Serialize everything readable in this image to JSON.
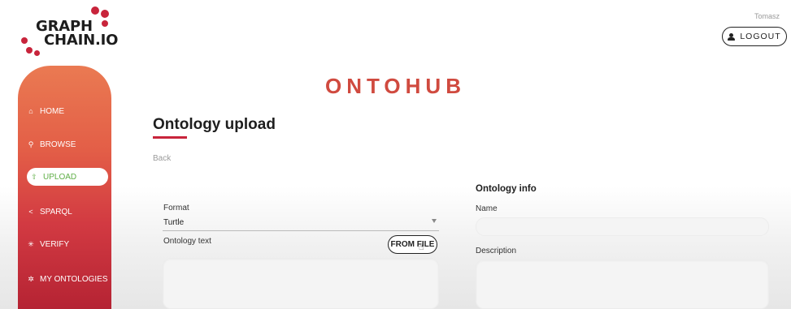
{
  "logo": {
    "line1": "GRAPH",
    "line2": "CHAIN.IO"
  },
  "header": {
    "username": "Tomasz",
    "logout_label": "LOGOUT",
    "logout_icon": "user-icon"
  },
  "sidebar": {
    "items": [
      {
        "label": "HOME",
        "icon": "home-icon",
        "glyph": "⌂"
      },
      {
        "label": "BROWSE",
        "icon": "search-icon",
        "glyph": "⚲"
      },
      {
        "label": "UPLOAD",
        "icon": "upload-icon",
        "glyph": "⇧"
      },
      {
        "label": "SPARQL",
        "icon": "share-icon",
        "glyph": "<"
      },
      {
        "label": "VERIFY",
        "icon": "verify-icon",
        "glyph": "✳"
      },
      {
        "label": "MY ONTOLOGIES",
        "icon": "gear-icon",
        "glyph": "✲"
      }
    ],
    "active": "UPLOAD",
    "colors": {
      "top": "#ea7a52",
      "bottom": "#b52333",
      "active_text": "#5fae46"
    }
  },
  "main": {
    "app_title": "ONTOHUB",
    "page_title": "Ontology upload",
    "back_label": "Back",
    "format": {
      "label": "Format",
      "selected": "Turtle"
    },
    "ontology_text": {
      "label": "Ontology text",
      "from_file_label": "FROM FILE"
    },
    "info": {
      "title": "Ontology info",
      "name_label": "Name",
      "name_value": "",
      "description_label": "Description",
      "description_value": ""
    }
  },
  "colors": {
    "accent": "#c8243b",
    "title": "#d04a3f"
  }
}
